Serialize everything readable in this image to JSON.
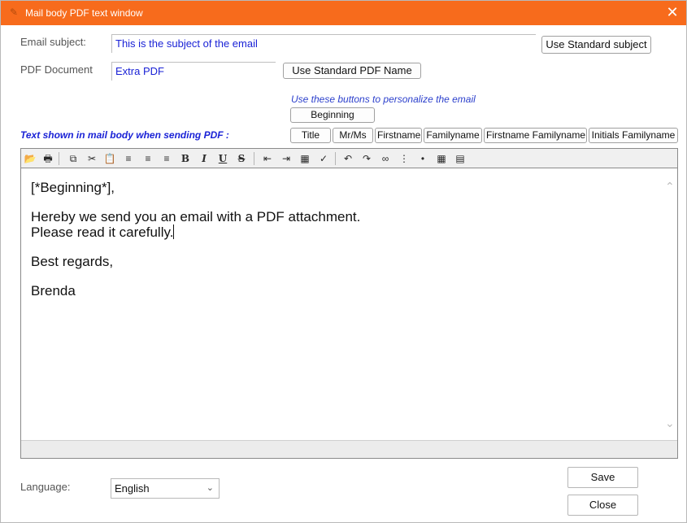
{
  "window": {
    "title": "Mail body PDF text window",
    "close_glyph": "✕",
    "accent_color": "#f76b1c"
  },
  "subject": {
    "label": "Email subject:",
    "value": "This is the subject of the email",
    "button": "Use Standard subject"
  },
  "pdf": {
    "label": "PDF Document",
    "value": "Extra PDF",
    "button": "Use Standard PDF Name"
  },
  "personalize": {
    "hint": "Use these buttons to personalize the email",
    "beginning": "Beginning",
    "buttons": [
      "Title",
      "Mr/Ms",
      "Firstname",
      "Familyname",
      "Firstname Familyname",
      "Initials Familyname"
    ]
  },
  "body_label": "Text shown in mail body when sending PDF :",
  "toolbar_icons": [
    "open-icon",
    "print-icon",
    "copy-icon",
    "cut-icon",
    "paste-icon",
    "align-left-icon",
    "align-center-icon",
    "align-right-icon",
    "bold-icon",
    "italic-icon",
    "underline-icon",
    "strikethrough-icon",
    "outdent-icon",
    "indent-icon",
    "font-color-icon",
    "spellcheck-icon",
    "undo-icon",
    "redo-icon",
    "link-icon",
    "numbered-list-icon",
    "bullet-list-icon",
    "table-icon",
    "horizontal-rule-icon"
  ],
  "editor": {
    "lines": [
      "[*Beginning*],",
      "",
      "Hereby we send you an email with a PDF attachment.",
      "Please read it carefully.",
      "",
      "Best regards,",
      "",
      "Brenda"
    ]
  },
  "language": {
    "label": "Language:",
    "selected": "English"
  },
  "actions": {
    "save": "Save",
    "close": "Close"
  }
}
